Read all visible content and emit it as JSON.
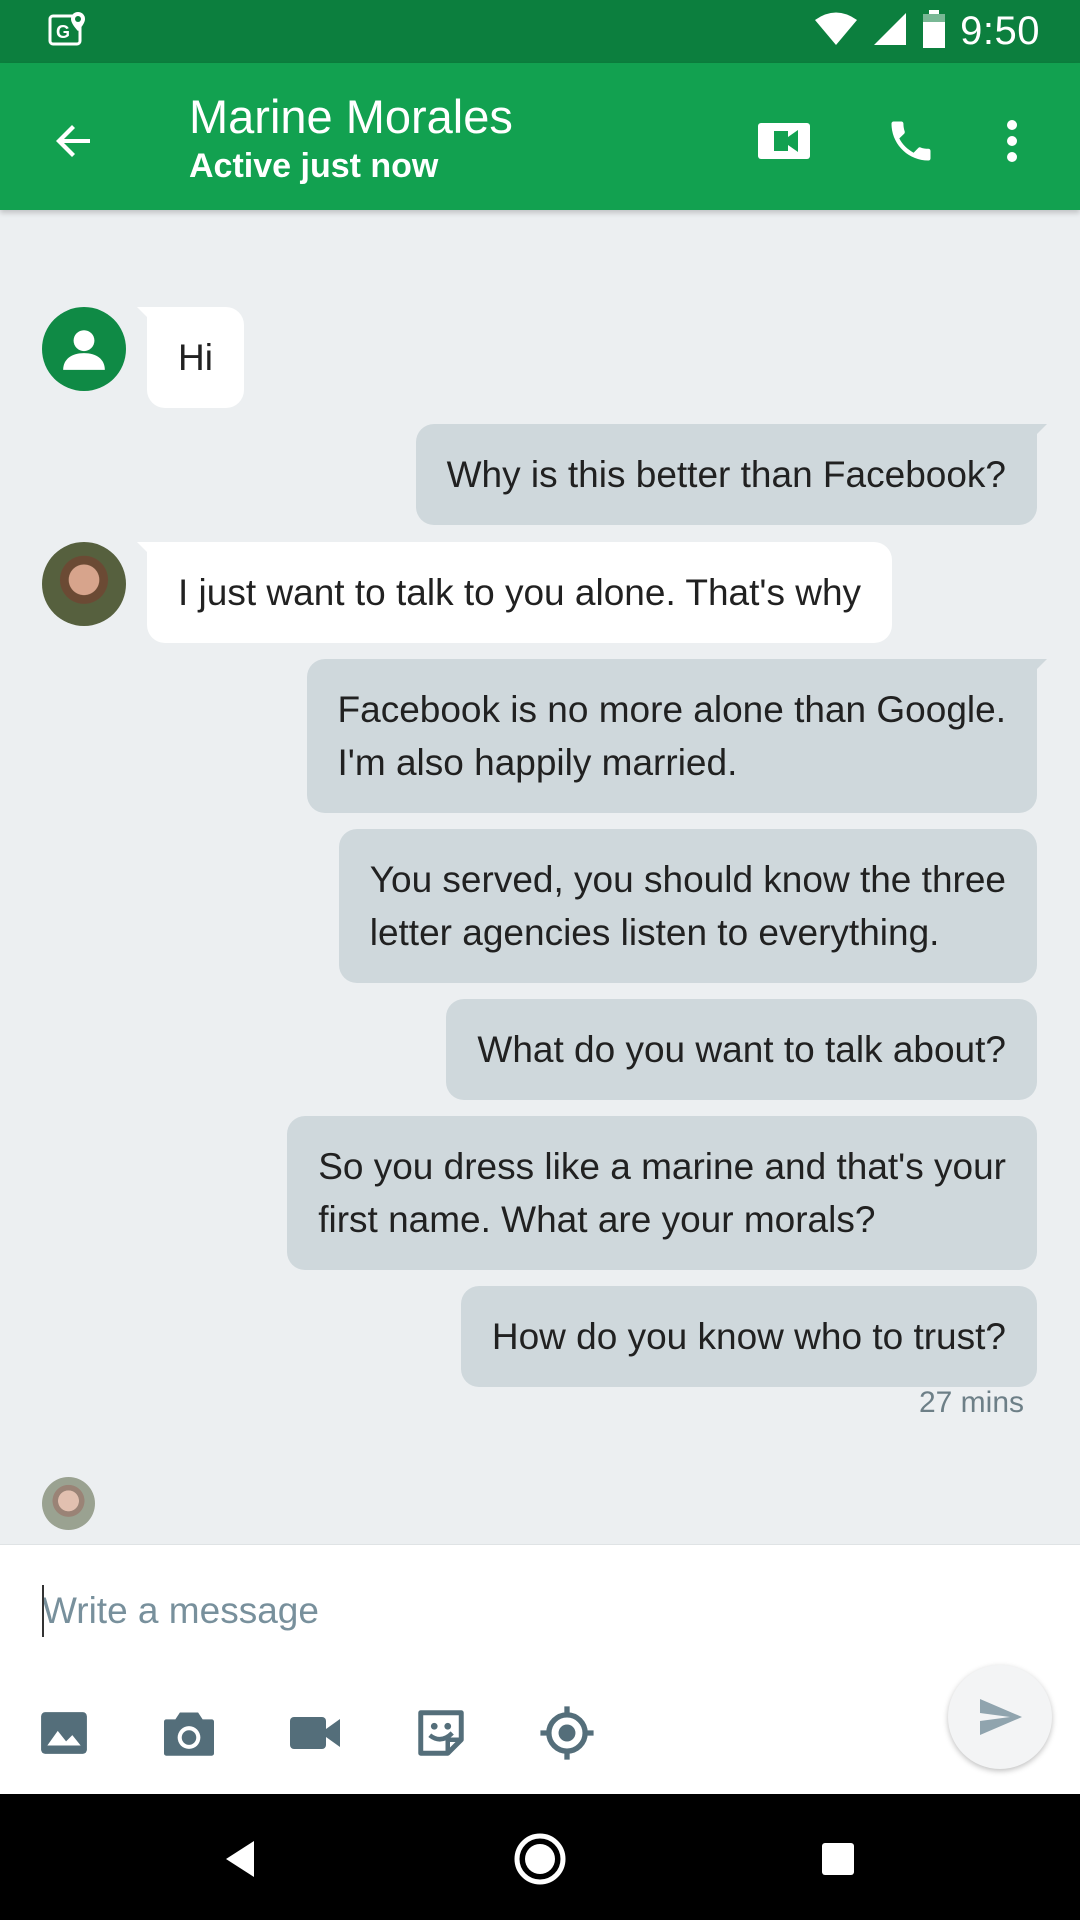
{
  "status_bar": {
    "time": "9:50",
    "icons": [
      "maps-notification-icon",
      "wifi-icon",
      "cellular-signal-icon",
      "battery-icon"
    ]
  },
  "header": {
    "contact_name": "Marine Morales",
    "contact_status": "Active just now",
    "actions": [
      "back-arrow-icon",
      "video-camera-icon",
      "phone-icon",
      "more-vert-icon"
    ]
  },
  "messages": [
    {
      "direction": "incoming",
      "text": "Hi",
      "avatar": "generic-person-icon"
    },
    {
      "direction": "outgoing",
      "text": "Why is this better than Facebook?"
    },
    {
      "direction": "incoming",
      "text": "I just want to talk to you alone. That's why",
      "avatar": "contact-photo"
    },
    {
      "direction": "outgoing",
      "text": "Facebook is no more alone than Google.\nI'm also happily married."
    },
    {
      "direction": "outgoing",
      "text": "You served, you should know the three\nletter agencies listen to everything."
    },
    {
      "direction": "outgoing",
      "text": "What do you want to talk about?"
    },
    {
      "direction": "outgoing",
      "text": "So you dress like a marine and that's your\nfirst name. What are your morals?"
    },
    {
      "direction": "outgoing",
      "text": "How do you know who to trust?"
    }
  ],
  "last_message_time": "27 mins",
  "compose": {
    "placeholder": "Write a message",
    "value": "",
    "attachments": [
      "image-icon",
      "camera-icon",
      "video-icon",
      "sticker-icon",
      "location-icon"
    ],
    "send_icon": "send-icon"
  },
  "colors": {
    "status_bar": "#0c7f3e",
    "app_bar": "#12a150",
    "conversation_bg": "#eceff1",
    "incoming_bubble": "#ffffff",
    "outgoing_bubble": "#cfd8dc"
  },
  "nav_bar": {
    "buttons": [
      "back-triangle-icon",
      "home-circle-icon",
      "recents-square-icon"
    ]
  }
}
